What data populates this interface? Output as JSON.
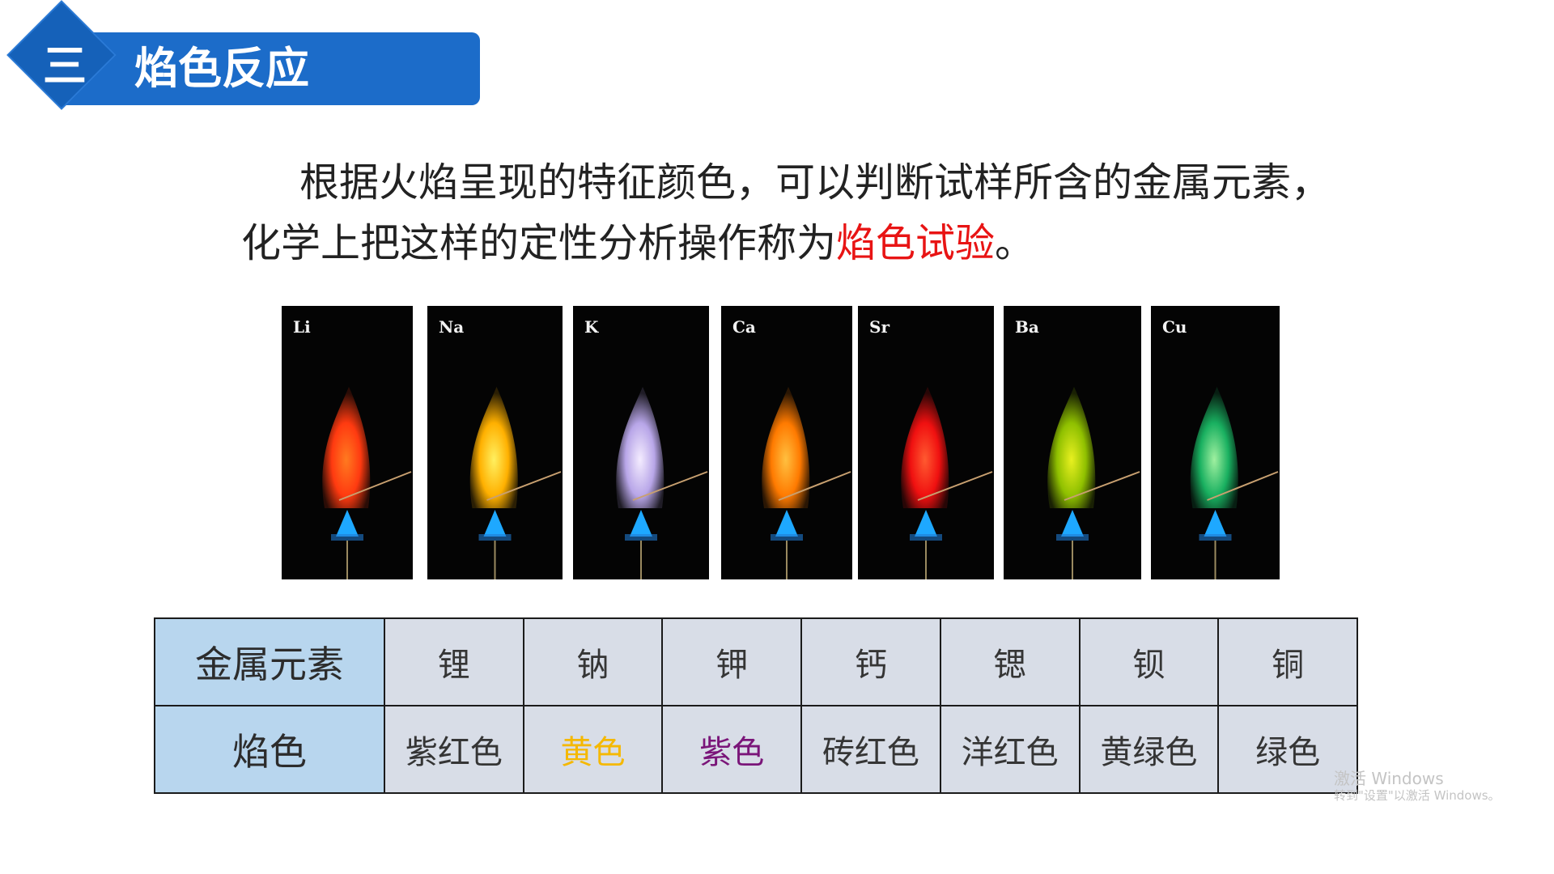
{
  "header": {
    "section_number": "三",
    "title": "焰色反应",
    "color": "#1c6cc9"
  },
  "paragraph": {
    "text_before": "根据火焰呈现的特征颜色，可以判断试样所含的金属元素，化学上把这样的定性分析操作称为",
    "highlight": "焰色试验",
    "text_after": "。",
    "highlight_color": "#e81414"
  },
  "flame_photos": [
    {
      "element": "Li",
      "flame_color": "#ff3a10",
      "core_color": "#ff7a20"
    },
    {
      "element": "Na",
      "flame_color": "#ffb000",
      "core_color": "#fff060"
    },
    {
      "element": "K",
      "flame_color": "#b8a6e8",
      "core_color": "#f4ecff"
    },
    {
      "element": "Ca",
      "flame_color": "#ff7a00",
      "core_color": "#ffc040"
    },
    {
      "element": "Sr",
      "flame_color": "#f01010",
      "core_color": "#ff5a30"
    },
    {
      "element": "Ba",
      "flame_color": "#8fc000",
      "core_color": "#e8f020"
    },
    {
      "element": "Cu",
      "flame_color": "#19b060",
      "core_color": "#a0f0a0"
    }
  ],
  "table": {
    "row_headers": [
      "金属元素",
      "焰色"
    ],
    "elements": [
      "锂",
      "钠",
      "钾",
      "钙",
      "锶",
      "钡",
      "铜"
    ],
    "colors": [
      {
        "text": "紫红色",
        "color": "#353535"
      },
      {
        "text": "黄色",
        "color": "#f5b800"
      },
      {
        "text": "紫色",
        "color": "#7a1579"
      },
      {
        "text": "砖红色",
        "color": "#353535"
      },
      {
        "text": "洋红色",
        "color": "#353535"
      },
      {
        "text": "黄绿色",
        "color": "#353535"
      },
      {
        "text": "绿色",
        "color": "#353535"
      }
    ]
  },
  "watermark": {
    "line1": "激活 Windows",
    "line2": "转到\"设置\"以激活 Windows。"
  }
}
